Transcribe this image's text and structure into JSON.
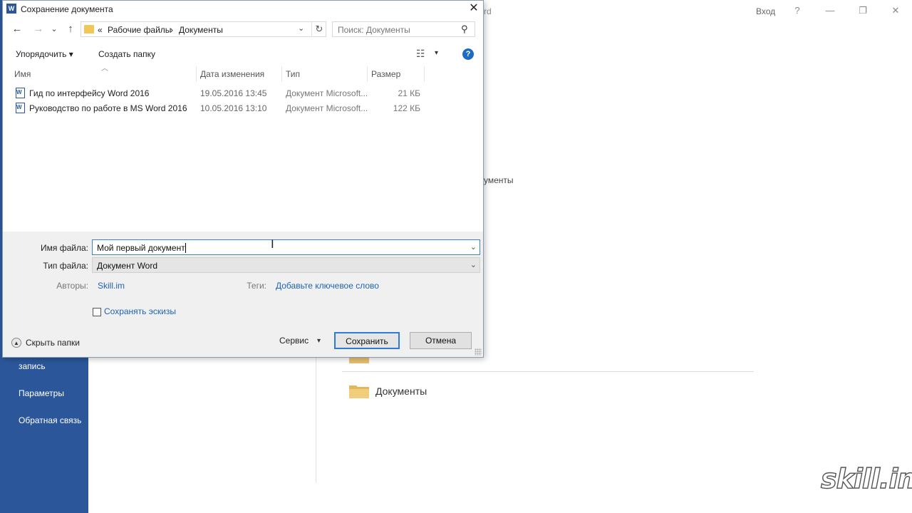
{
  "background": {
    "title_fragment": "rd",
    "sign_in": "Вход",
    "window_buttons": {
      "help": "?",
      "minimize": "—",
      "restore": "❐",
      "close": "✕"
    },
    "sidebar_items": [
      {
        "label": "запись"
      },
      {
        "label": "Параметры"
      },
      {
        "label": "Обратная связь"
      }
    ],
    "content_fragment": "ументы",
    "folder_label": "Документы",
    "folder_color": "#f0c85a",
    "sidebar_color": "#2b579a",
    "watermark": "skill.im"
  },
  "dialog": {
    "title": "Сохранение документа",
    "app_icon": "W",
    "close_glyph": "✕",
    "nav": {
      "back_icon": "←",
      "forward_icon": "→",
      "recent_icon": "⌄",
      "up_icon": "↑"
    },
    "address": {
      "prefix": "«",
      "crumbs": [
        "Рабочие файлы",
        "Документы"
      ],
      "separator": "›",
      "dropdown_glyph": "⌄",
      "refresh_glyph": "↻"
    },
    "search": {
      "placeholder": "Поиск: Документы",
      "icon_glyph": "⚲"
    },
    "toolbar": {
      "organize": "Упорядочить",
      "new_folder": "Создать папку",
      "view_glyph": "☷",
      "dropdown_glyph": "▾",
      "help_glyph": "?"
    },
    "columns": {
      "name": "Имя",
      "date": "Дата изменения",
      "type": "Тип",
      "size": "Размер",
      "sort_glyph": "︿"
    },
    "files": [
      {
        "name": "Гид по интерфейсу Word 2016",
        "date": "19.05.2016 13:45",
        "type": "Документ Microsoft...",
        "size": "21 КБ"
      },
      {
        "name": "Руководство по работе в MS Word 2016",
        "date": "10.05.2016 13:10",
        "type": "Документ Microsoft...",
        "size": "122 КБ"
      }
    ],
    "form": {
      "filename_label": "Имя файла:",
      "filename_value": "Мой первый документ",
      "filetype_label": "Тип файла:",
      "filetype_value": "Документ Word",
      "authors_label": "Авторы:",
      "authors_value": "Skill.im",
      "tags_label": "Теги:",
      "tags_value": "Добавьте ключевое слово",
      "thumbnails_label": "Сохранять эскизы",
      "caret_glyph": "⌄"
    },
    "footer": {
      "hide_folders": "Скрыть папки",
      "hide_glyph": "▲",
      "service": "Сервис",
      "service_glyph": "▾",
      "save": "Сохранить",
      "cancel": "Отмена"
    },
    "accent_color": "#2e7bd6"
  }
}
